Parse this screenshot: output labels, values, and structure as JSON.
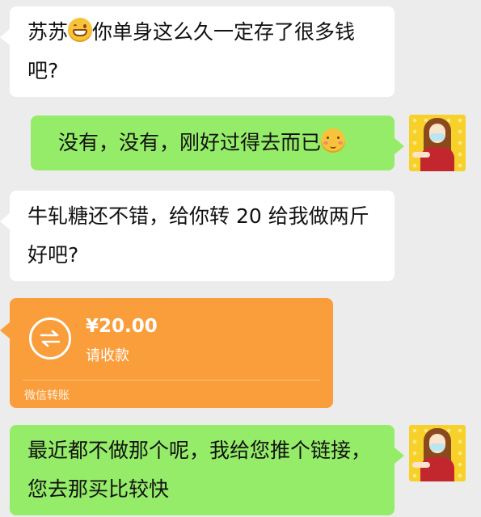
{
  "messages": [
    {
      "side": "left",
      "text_before": "苏苏",
      "emoji": "grin-emoji",
      "text_after": "你单身这么久一定存了很多钱吧?"
    },
    {
      "side": "right",
      "text": "没有，没有，刚好过得去而已",
      "emoji": "blush-emoji"
    },
    {
      "side": "left",
      "text": "牛轧糖还不错，给你转 20 给我做两斤好吧?"
    },
    {
      "side": "right",
      "text": "最近都不做那个呢，我给您推个链接，您去那买比较快"
    }
  ],
  "transfer": {
    "amount": "¥20.00",
    "status": "请收款",
    "footer": "微信转账"
  },
  "colors": {
    "background": "#ececec",
    "incoming_bubble": "#ffffff",
    "outgoing_bubble": "#95ec69",
    "transfer_card": "#fa9d3b"
  },
  "icons": [
    "grin-emoji",
    "blush-emoji",
    "transfer-arrows-icon",
    "user-avatar"
  ]
}
